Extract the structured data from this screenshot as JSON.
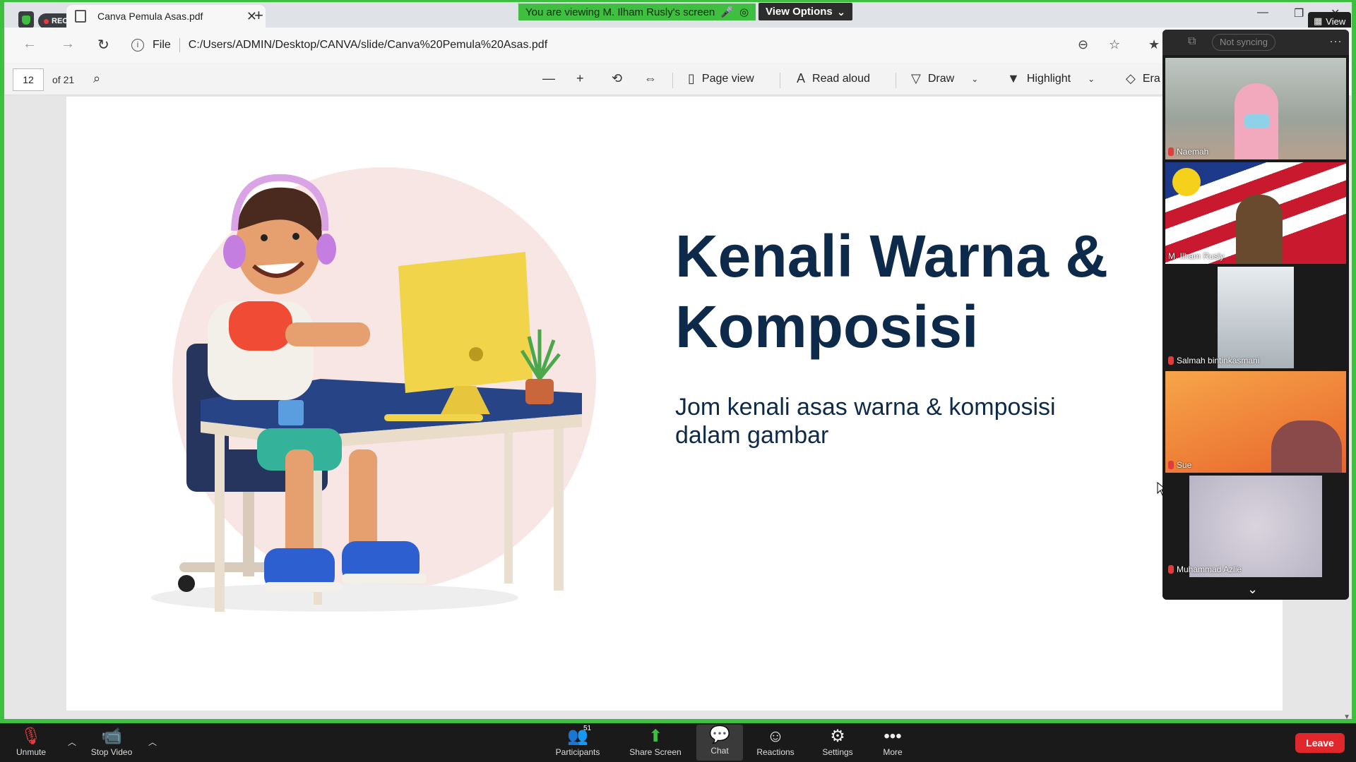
{
  "browser": {
    "rec_label": "REC",
    "tab_title": "Canva Pemula Asas.pdf",
    "tab_close": "✕",
    "new_tab": "+",
    "url_prefix": "File",
    "url": "C:/Users/ADMIN/Desktop/CANVA/slide/Canva%20Pemula%20Asas.pdf"
  },
  "share": {
    "banner": "You are viewing M. Ilham Rusly's screen",
    "view_options": "View Options",
    "view_label": "View"
  },
  "pdf_toolbar": {
    "page_current": "12",
    "page_total": "of 21",
    "page_view": "Page view",
    "read_aloud": "Read aloud",
    "draw": "Draw",
    "highlight": "Highlight",
    "erase": "Era"
  },
  "slide": {
    "title_line1": "Kenali Warna &",
    "title_line2": "Komposisi",
    "subtitle_line1": "Jom kenali asas warna & komposisi",
    "subtitle_line2": "dalam gambar"
  },
  "gallery": {
    "sync_label": "Not syncing",
    "participants": [
      {
        "name": "Naemah"
      },
      {
        "name": "M. Ilham Rusly"
      },
      {
        "name": "Salmah bintinkasmani"
      },
      {
        "name": "Sue"
      },
      {
        "name": "Muhammad Azlie"
      }
    ]
  },
  "zoom_bar": {
    "unmute": "Unmute",
    "stop_video": "Stop Video",
    "participants": "Participants",
    "participant_count": "51",
    "share_screen": "Share Screen",
    "chat": "Chat",
    "reactions": "Reactions",
    "settings": "Settings",
    "more": "More",
    "leave": "Leave"
  },
  "colors": {
    "share_green": "#3fbf3f",
    "title_navy": "#0e2a4a",
    "leave_red": "#e0282c"
  }
}
